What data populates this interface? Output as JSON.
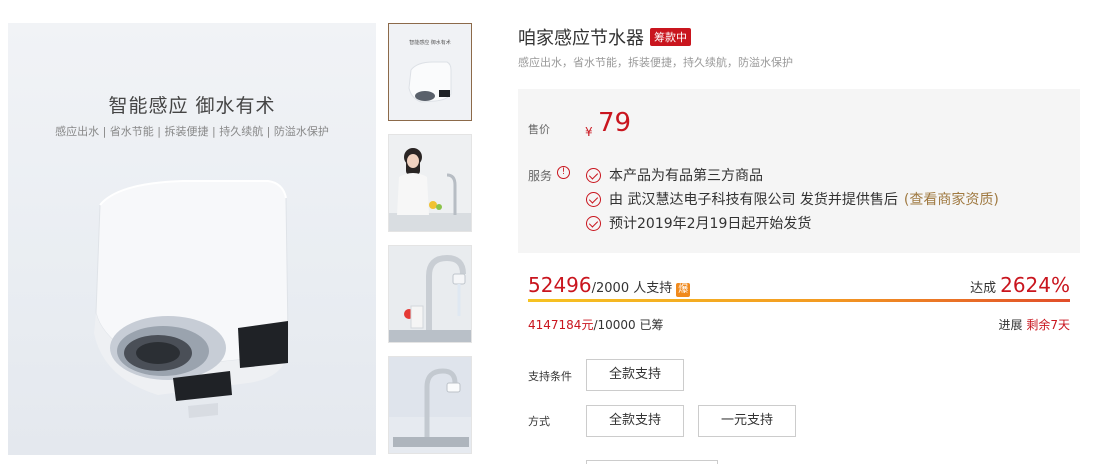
{
  "gallery": {
    "main": {
      "slogan": "智能感应 御水有术",
      "tagline": "感应出水 | 省水节能 | 拆装便捷 | 持久续航 | 防溢水保护"
    },
    "thumb1_text": "智能感应 御水有术",
    "thumbnails": [
      "faucet-product-thumb",
      "woman-washing-thumb",
      "faucet-water-thumb",
      "faucet-sink-thumb"
    ]
  },
  "product": {
    "title": "咱家感应节水器",
    "status_badge": "筹款中",
    "subtitle": "感应出水，省水节能，拆装便捷，持久续航，防溢水保护"
  },
  "price": {
    "label": "售价",
    "currency": "¥",
    "value": "79"
  },
  "service": {
    "label": "服务",
    "info_icon": "!",
    "items": [
      {
        "text": "本产品为有品第三方商品"
      },
      {
        "prefix": "由 武汉慧达电子科技有限公司 发货并提供售后",
        "link": "(查看商家资质)"
      },
      {
        "text": "预计2019年2月19日起开始发货"
      }
    ]
  },
  "crowdfunding": {
    "supporters": "52496",
    "supporters_target": "/2000 人支持",
    "hot_badge": "爆",
    "reach_label": "达成",
    "reach_percent": "2624%",
    "progress_fraction": 1.0,
    "raised_amount": "4147184元",
    "raised_target": "/10000 已筹",
    "progress_label": "进展",
    "remaining": "剩余7天"
  },
  "options": {
    "condition_label": "支持条件",
    "condition_values": [
      "全款支持"
    ],
    "method_label": "方式",
    "method_values": [
      "全款支持",
      "一元支持"
    ]
  },
  "colors": {
    "accent_red": "#c9151e",
    "link_brown": "#a07a42",
    "hot_orange": "#f08a1d"
  }
}
